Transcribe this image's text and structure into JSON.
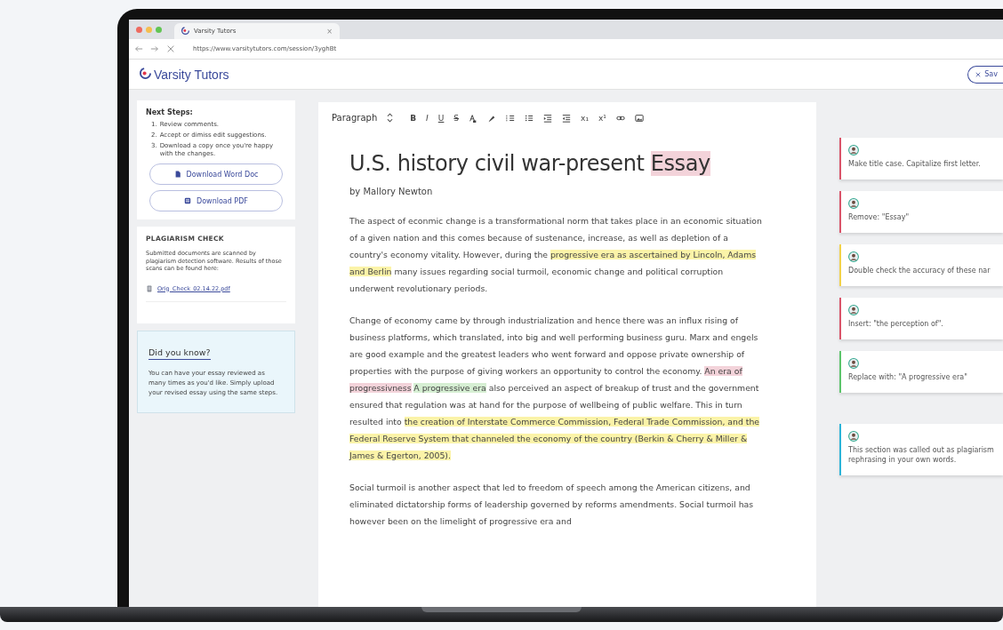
{
  "browser": {
    "tab_title": "Varsity Tutors",
    "tab_close": "×",
    "url": "https://www.varsitytutors.com/session/3yghBt"
  },
  "app_header": {
    "logo": "Varsity Tutors",
    "save_button": "Sav"
  },
  "sidebar": {
    "next_steps": {
      "title": "Next Steps:",
      "steps": [
        {
          "number": "1.",
          "text": "Review comments."
        },
        {
          "number": "2.",
          "text": "Accept or dimiss edit suggestions."
        },
        {
          "number": "3.",
          "text": "Download a copy once you're happy with the changes."
        }
      ],
      "buttons": [
        {
          "kind": "word",
          "label": "Download Word Doc"
        },
        {
          "kind": "pdf",
          "label": "Download PDF"
        }
      ]
    },
    "plagiarism": {
      "title": "PLAGIARISM CHECK",
      "text": "Submitted documents are scanned by plagiarism detection software. Results of those scans can be found here:",
      "file": "Orig_Check_02.14.22.pdf"
    },
    "did_you_know": {
      "title": "Did you know?",
      "text": "You can have your essay reviewed as many times as you'd like. Simply upload your revised essay using the same steps."
    }
  },
  "toolbar": {
    "format": "Paragraph",
    "tools": [
      {
        "kind": "bold",
        "label": "B"
      },
      {
        "kind": "italic",
        "label": "I"
      },
      {
        "kind": "underline",
        "label": "U"
      },
      {
        "kind": "strikethrough",
        "label": "S"
      },
      {
        "kind": "font-color"
      },
      {
        "kind": "highlighter"
      },
      {
        "kind": "ordered-list"
      },
      {
        "kind": "bullet-list"
      },
      {
        "kind": "indent"
      },
      {
        "kind": "outdent"
      },
      {
        "kind": "subscript",
        "label": "x₁"
      },
      {
        "kind": "superscript",
        "label": "x¹"
      },
      {
        "kind": "link"
      },
      {
        "kind": "image"
      }
    ]
  },
  "document": {
    "title": [
      {
        "kind": "plain",
        "text": "U.S. history civil war-present "
      },
      {
        "kind": "highlight",
        "color": "#f3d3da",
        "text": "Essay"
      }
    ],
    "author": "by Mallory Newton",
    "paragraphs": [
      [
        {
          "kind": "plain",
          "text": "The aspect of econmic change is a transformational norm that takes place in an economic situation of a given nation and this comes because of sustenance, increase, as well as depletion of a country's economy vitality. However, during the "
        },
        {
          "kind": "highlight",
          "color": "#fbf3a8",
          "text": "progressive era as ascertained by Lincoln, Adams and Berlin"
        },
        {
          "kind": "plain",
          "text": " many issues regarding social turmoil, economic change and political corruption underwent revolutionary periods."
        }
      ],
      [
        {
          "kind": "plain",
          "text": "Change of economy came by through industrialization and hence there was an influx rising of business platforms, which translated, into big and well performing business guru. Marx and engels are good example and the greatest leaders who went forward and oppose private ownership of properties with the purpose of giving workers an opportunity to control the economy. "
        },
        {
          "kind": "highlight",
          "color": "#f3d3da",
          "text": "An era of progressivness"
        },
        {
          "kind": "highlight",
          "color": "#d6efd3",
          "text": "A progressive era"
        },
        {
          "kind": "plain",
          "text": " also perceived an aspect of breakup of trust and the government ensured that regulation was at hand for the purpose of wellbeing of public welfare. This in turn resulted into "
        },
        {
          "kind": "highlight",
          "color": "#fbf3a8",
          "text": "the creation of Interstate Commerce Commission, Federal Trade Commission, and the Federal Reserve System that channeled the economy of the country (Berkin & Cherry & Miller & James & Egerton, 2005)."
        }
      ],
      [
        {
          "kind": "plain",
          "text": "Social turmoil is another aspect that led to freedom of speech among the American citizens, and eliminated dictatorship forms of leadership governed by reforms amendments. Social turmoil has however been on the limelight of progressive era and"
        }
      ]
    ]
  },
  "comments": [
    {
      "text": "Make title case. Capitalize first letter.",
      "color": "#d9546a"
    },
    {
      "text": "Remove: \"Essay\"",
      "color": "#d9546a"
    },
    {
      "text": "Double check the accuracy of these nar",
      "color": "#f2d24a"
    },
    {
      "text": "Insert: \"the perception of\".",
      "color": "#d9546a"
    },
    {
      "text": "Replace with: \"A progressive era\"",
      "color": "#5cc46b"
    },
    {
      "text": "This section was called out as plagiarism rephrasing in your own words.",
      "color": "#2bb3d8"
    }
  ]
}
